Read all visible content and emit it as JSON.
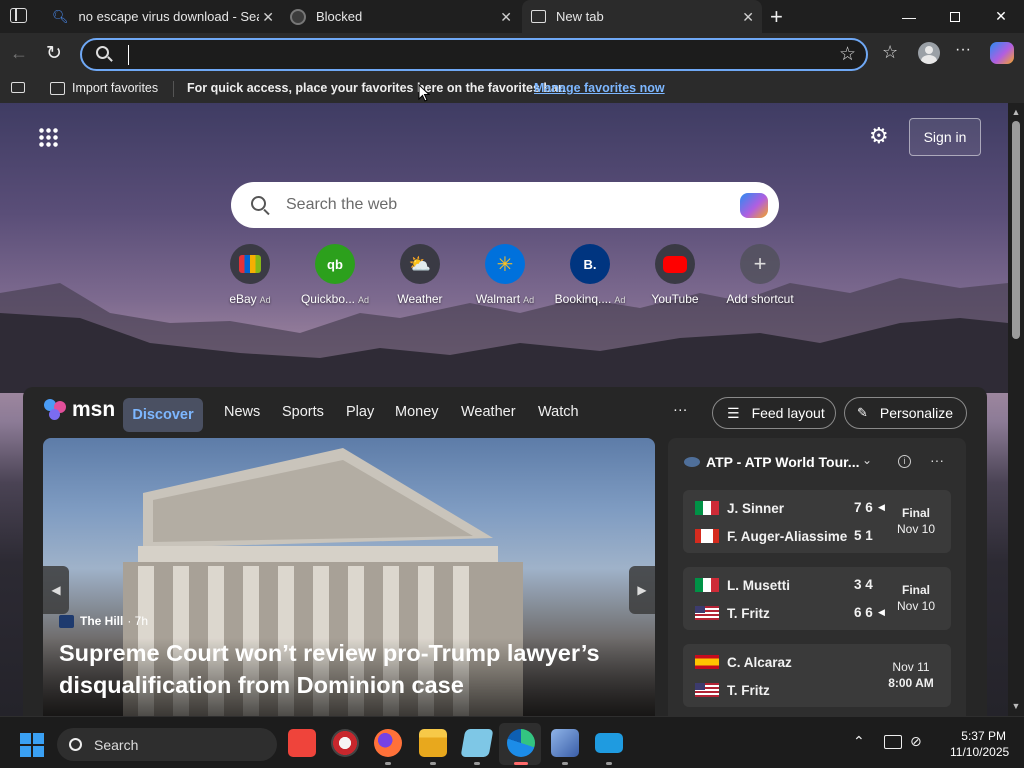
{
  "tabs": [
    {
      "title": "no escape virus download - Search"
    },
    {
      "title": "Blocked"
    },
    {
      "title": "New tab"
    }
  ],
  "addressbar": {
    "value": ""
  },
  "favbar": {
    "import_label": "Import favorites",
    "message": "For quick access, place your favorites here on the favorites bar.",
    "manage_link": "Manage favorites now"
  },
  "header": {
    "sign_in": "Sign in"
  },
  "search": {
    "placeholder": "Search the web"
  },
  "shortcuts": [
    {
      "label": "eBay",
      "ad": "Ad",
      "icon": "ebay-icon"
    },
    {
      "label": "Quickbo...",
      "ad": "Ad",
      "icon": "quickbooks-icon"
    },
    {
      "label": "Weather",
      "ad": "",
      "icon": "weather-icon"
    },
    {
      "label": "Walmart",
      "ad": "Ad",
      "icon": "walmart-icon"
    },
    {
      "label": "Bookinq....",
      "ad": "Ad",
      "icon": "booking-icon"
    },
    {
      "label": "YouTube",
      "ad": "",
      "icon": "youtube-icon"
    },
    {
      "label": "Add shortcut",
      "ad": "",
      "icon": "plus-icon"
    }
  ],
  "feed": {
    "logo": "msn",
    "nav": [
      "Discover",
      "News",
      "Sports",
      "Play",
      "Money",
      "Weather",
      "Watch"
    ],
    "more": "···",
    "feed_layout": "Feed layout",
    "personalize": "Personalize"
  },
  "hero": {
    "source": "The Hill",
    "time": "· 7h",
    "headline_line1": "Supreme Court won’t review pro-Trump lawyer’s",
    "headline_line2": "disqualification from Dominion case"
  },
  "sports": {
    "title": "ATP - ATP World Tour...",
    "matches": [
      {
        "p1": "J. Sinner",
        "p1_flag": "italy",
        "p1_score": "7 6",
        "p2": "F. Auger-Aliassime",
        "p2_flag": "canada",
        "p2_score": "5 1",
        "status": "Final",
        "date": "Nov 10",
        "winner": 1
      },
      {
        "p1": "L. Musetti",
        "p1_flag": "italy",
        "p1_score": "3 4",
        "p2": "T. Fritz",
        "p2_flag": "usa",
        "p2_score": "6 6",
        "status": "Final",
        "date": "Nov 10",
        "winner": 2
      },
      {
        "p1": "C. Alcaraz",
        "p1_flag": "spain",
        "p1_score": "",
        "p2": "T. Fritz",
        "p2_flag": "usa",
        "p2_score": "",
        "status": "Nov 11",
        "date": "8:00 AM",
        "winner": 0
      }
    ]
  },
  "taskbar": {
    "search": "Search",
    "time": "5:37 PM",
    "date": "11/10/2025"
  },
  "colors": {
    "accent": "#6fa8f5",
    "link": "#7db7ff",
    "discover_pill": "#4a5062"
  }
}
